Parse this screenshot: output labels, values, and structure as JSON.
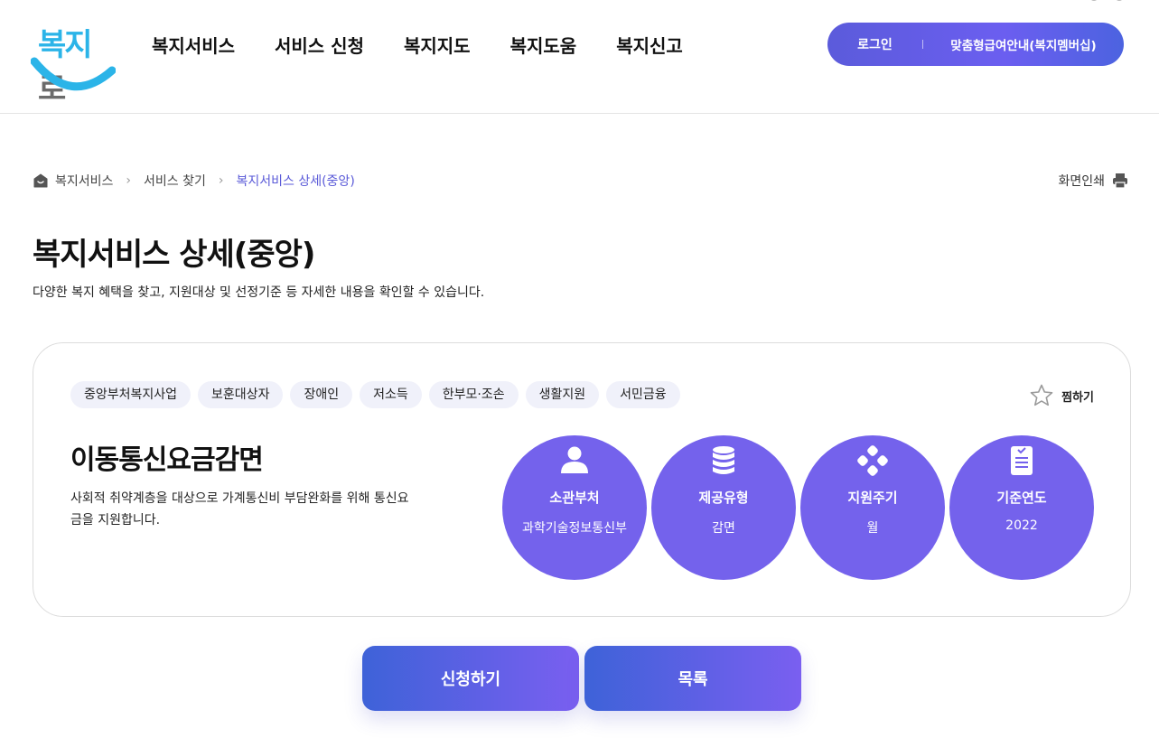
{
  "header": {
    "logo_text_main": "복지",
    "logo_text_end": "로",
    "nav": [
      {
        "label": "복지서비스"
      },
      {
        "label": "서비스 신청"
      },
      {
        "label": "복지지도"
      },
      {
        "label": "복지도움"
      },
      {
        "label": "복지신고"
      }
    ],
    "util": {
      "login": "로그인",
      "member": "맞춤형급여안내(복지멤버십)"
    }
  },
  "breadcrumb": {
    "items": [
      "복지서비스",
      "서비스 찾기",
      "복지서비스 상세(중앙)"
    ],
    "print_label": "화면인쇄"
  },
  "page": {
    "title": "복지서비스 상세(중앙)",
    "desc": "다양한 복지 혜택을 찾고, 지원대상 및 선정기준 등 자세한 내용을 확인할 수 있습니다."
  },
  "card": {
    "tags": [
      "중앙부처복지사업",
      "보훈대상자",
      "장애인",
      "저소득",
      "한부모·조손",
      "생활지원",
      "서민금융"
    ],
    "bookmark_label": "찜하기",
    "service_title": "이동통신요금감면",
    "service_desc": "사회적 취약계층을 대상으로 가계통신비 부담완화를 위해 통신요금을 지원합니다.",
    "info": [
      {
        "label": "소관부처",
        "value": "과학기술정보통신부",
        "icon": "person-icon"
      },
      {
        "label": "제공유형",
        "value": "감면",
        "icon": "database-icon"
      },
      {
        "label": "지원주기",
        "value": "월",
        "icon": "cycle-icon"
      },
      {
        "label": "기준연도",
        "value": "2022",
        "icon": "clipboard-icon"
      }
    ]
  },
  "buttons": {
    "apply": "신청하기",
    "list": "목록"
  },
  "colors": {
    "accent": "#7462ec",
    "breadcrumb_active": "#5a5ad8",
    "logo_blue": "#2bb4e8"
  }
}
